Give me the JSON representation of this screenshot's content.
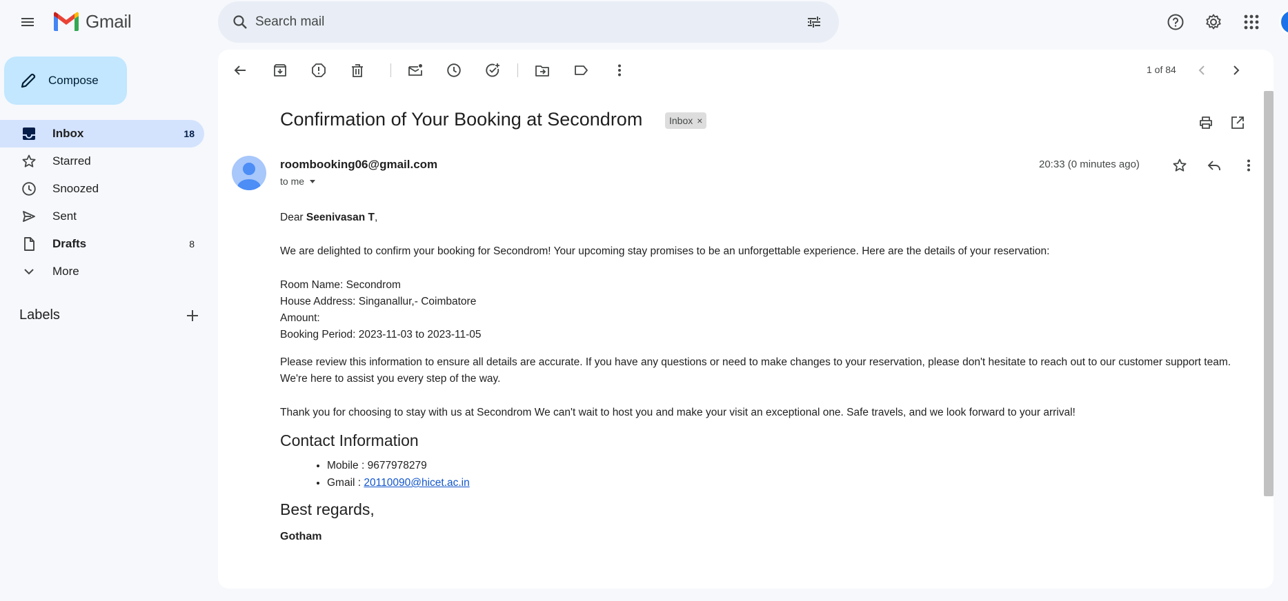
{
  "app": {
    "name": "Gmail"
  },
  "search": {
    "placeholder": "Search mail"
  },
  "compose": {
    "label": "Compose"
  },
  "sidebar": {
    "items": [
      {
        "label": "Inbox",
        "count": "18"
      },
      {
        "label": "Starred",
        "count": ""
      },
      {
        "label": "Snoozed",
        "count": ""
      },
      {
        "label": "Sent",
        "count": ""
      },
      {
        "label": "Drafts",
        "count": "8"
      },
      {
        "label": "More",
        "count": ""
      }
    ],
    "labels_title": "Labels"
  },
  "toolbar": {
    "pager": "1 of 84"
  },
  "email": {
    "subject": "Confirmation of Your Booking at Secondrom",
    "chip": "Inbox",
    "chip_close": "×",
    "sender": "roombooking06@gmail.com",
    "to": "to me",
    "time": "20:33 (0 minutes ago)",
    "greeting_prefix": "Dear ",
    "greeting_name": "Seenivasan T",
    "greeting_suffix": ",",
    "intro": "We are delighted to confirm your booking for Secondrom! Your upcoming stay promises to be an unforgettable experience. Here are the details of your reservation:",
    "room_name": "Room Name: Secondrom",
    "address": "House Address: Singanallur,- Coimbatore",
    "amount": "Amount:",
    "period": "Booking Period: 2023-11-03 to 2023-11-05",
    "review": "Please review this information to ensure all details are accurate. If you have any questions or need to make changes to your reservation, please don't hesitate to reach out to our customer support team. We're here to assist you every step of the way.",
    "thanks": "Thank you for choosing to stay with us at Secondrom We can't wait to host you and make your visit an exceptional one. Safe travels, and we look forward to your arrival!",
    "contact_heading": "Contact Information",
    "mobile": "Mobile : 9677978279",
    "gmail_prefix": "Gmail : ",
    "gmail_link": "20110090@hicet.ac.in",
    "regards": "Best regards,",
    "signature": "Gotham"
  },
  "colors": {
    "accent": "#0b57d0",
    "compose_bg": "#c2e7ff",
    "active_nav": "#d3e3fd",
    "page_bg": "#f6f8fc"
  }
}
